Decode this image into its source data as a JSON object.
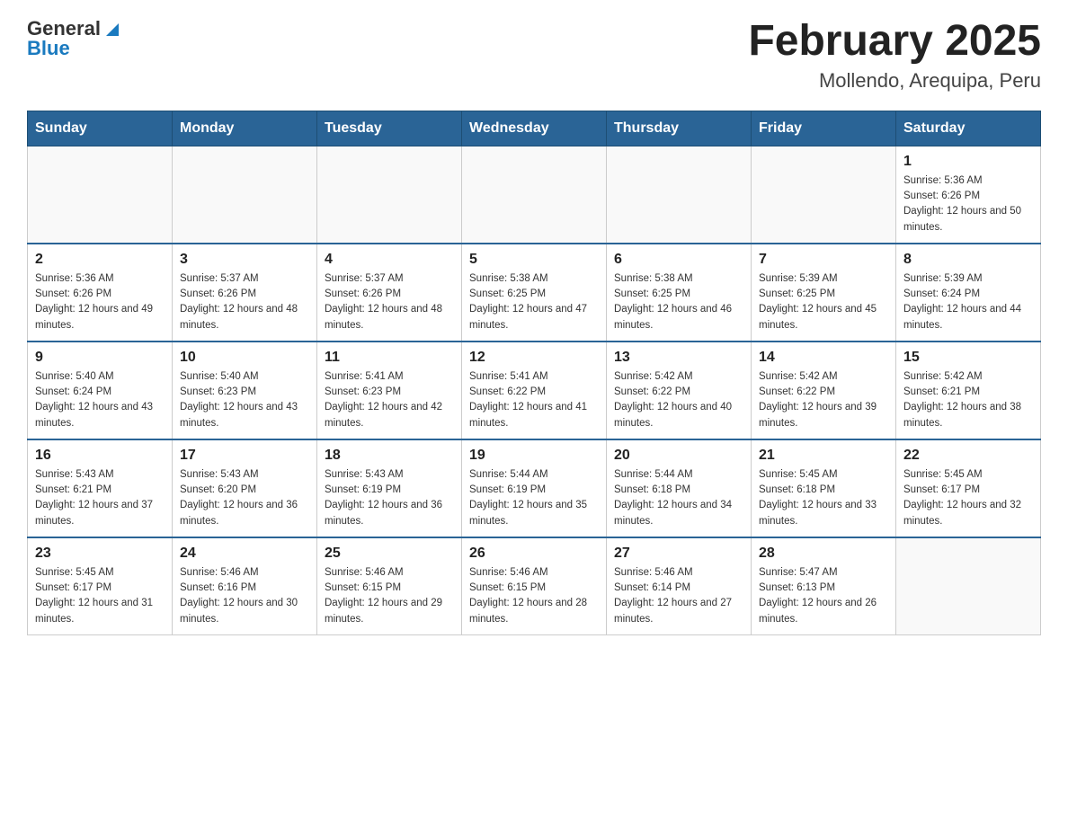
{
  "header": {
    "logo": {
      "general": "General",
      "blue": "Blue"
    },
    "title": "February 2025",
    "location": "Mollendo, Arequipa, Peru"
  },
  "days_of_week": [
    "Sunday",
    "Monday",
    "Tuesday",
    "Wednesday",
    "Thursday",
    "Friday",
    "Saturday"
  ],
  "weeks": [
    [
      {
        "day": "",
        "sunrise": "",
        "sunset": "",
        "daylight": ""
      },
      {
        "day": "",
        "sunrise": "",
        "sunset": "",
        "daylight": ""
      },
      {
        "day": "",
        "sunrise": "",
        "sunset": "",
        "daylight": ""
      },
      {
        "day": "",
        "sunrise": "",
        "sunset": "",
        "daylight": ""
      },
      {
        "day": "",
        "sunrise": "",
        "sunset": "",
        "daylight": ""
      },
      {
        "day": "",
        "sunrise": "",
        "sunset": "",
        "daylight": ""
      },
      {
        "day": "1",
        "sunrise": "Sunrise: 5:36 AM",
        "sunset": "Sunset: 6:26 PM",
        "daylight": "Daylight: 12 hours and 50 minutes."
      }
    ],
    [
      {
        "day": "2",
        "sunrise": "Sunrise: 5:36 AM",
        "sunset": "Sunset: 6:26 PM",
        "daylight": "Daylight: 12 hours and 49 minutes."
      },
      {
        "day": "3",
        "sunrise": "Sunrise: 5:37 AM",
        "sunset": "Sunset: 6:26 PM",
        "daylight": "Daylight: 12 hours and 48 minutes."
      },
      {
        "day": "4",
        "sunrise": "Sunrise: 5:37 AM",
        "sunset": "Sunset: 6:26 PM",
        "daylight": "Daylight: 12 hours and 48 minutes."
      },
      {
        "day": "5",
        "sunrise": "Sunrise: 5:38 AM",
        "sunset": "Sunset: 6:25 PM",
        "daylight": "Daylight: 12 hours and 47 minutes."
      },
      {
        "day": "6",
        "sunrise": "Sunrise: 5:38 AM",
        "sunset": "Sunset: 6:25 PM",
        "daylight": "Daylight: 12 hours and 46 minutes."
      },
      {
        "day": "7",
        "sunrise": "Sunrise: 5:39 AM",
        "sunset": "Sunset: 6:25 PM",
        "daylight": "Daylight: 12 hours and 45 minutes."
      },
      {
        "day": "8",
        "sunrise": "Sunrise: 5:39 AM",
        "sunset": "Sunset: 6:24 PM",
        "daylight": "Daylight: 12 hours and 44 minutes."
      }
    ],
    [
      {
        "day": "9",
        "sunrise": "Sunrise: 5:40 AM",
        "sunset": "Sunset: 6:24 PM",
        "daylight": "Daylight: 12 hours and 43 minutes."
      },
      {
        "day": "10",
        "sunrise": "Sunrise: 5:40 AM",
        "sunset": "Sunset: 6:23 PM",
        "daylight": "Daylight: 12 hours and 43 minutes."
      },
      {
        "day": "11",
        "sunrise": "Sunrise: 5:41 AM",
        "sunset": "Sunset: 6:23 PM",
        "daylight": "Daylight: 12 hours and 42 minutes."
      },
      {
        "day": "12",
        "sunrise": "Sunrise: 5:41 AM",
        "sunset": "Sunset: 6:22 PM",
        "daylight": "Daylight: 12 hours and 41 minutes."
      },
      {
        "day": "13",
        "sunrise": "Sunrise: 5:42 AM",
        "sunset": "Sunset: 6:22 PM",
        "daylight": "Daylight: 12 hours and 40 minutes."
      },
      {
        "day": "14",
        "sunrise": "Sunrise: 5:42 AM",
        "sunset": "Sunset: 6:22 PM",
        "daylight": "Daylight: 12 hours and 39 minutes."
      },
      {
        "day": "15",
        "sunrise": "Sunrise: 5:42 AM",
        "sunset": "Sunset: 6:21 PM",
        "daylight": "Daylight: 12 hours and 38 minutes."
      }
    ],
    [
      {
        "day": "16",
        "sunrise": "Sunrise: 5:43 AM",
        "sunset": "Sunset: 6:21 PM",
        "daylight": "Daylight: 12 hours and 37 minutes."
      },
      {
        "day": "17",
        "sunrise": "Sunrise: 5:43 AM",
        "sunset": "Sunset: 6:20 PM",
        "daylight": "Daylight: 12 hours and 36 minutes."
      },
      {
        "day": "18",
        "sunrise": "Sunrise: 5:43 AM",
        "sunset": "Sunset: 6:19 PM",
        "daylight": "Daylight: 12 hours and 36 minutes."
      },
      {
        "day": "19",
        "sunrise": "Sunrise: 5:44 AM",
        "sunset": "Sunset: 6:19 PM",
        "daylight": "Daylight: 12 hours and 35 minutes."
      },
      {
        "day": "20",
        "sunrise": "Sunrise: 5:44 AM",
        "sunset": "Sunset: 6:18 PM",
        "daylight": "Daylight: 12 hours and 34 minutes."
      },
      {
        "day": "21",
        "sunrise": "Sunrise: 5:45 AM",
        "sunset": "Sunset: 6:18 PM",
        "daylight": "Daylight: 12 hours and 33 minutes."
      },
      {
        "day": "22",
        "sunrise": "Sunrise: 5:45 AM",
        "sunset": "Sunset: 6:17 PM",
        "daylight": "Daylight: 12 hours and 32 minutes."
      }
    ],
    [
      {
        "day": "23",
        "sunrise": "Sunrise: 5:45 AM",
        "sunset": "Sunset: 6:17 PM",
        "daylight": "Daylight: 12 hours and 31 minutes."
      },
      {
        "day": "24",
        "sunrise": "Sunrise: 5:46 AM",
        "sunset": "Sunset: 6:16 PM",
        "daylight": "Daylight: 12 hours and 30 minutes."
      },
      {
        "day": "25",
        "sunrise": "Sunrise: 5:46 AM",
        "sunset": "Sunset: 6:15 PM",
        "daylight": "Daylight: 12 hours and 29 minutes."
      },
      {
        "day": "26",
        "sunrise": "Sunrise: 5:46 AM",
        "sunset": "Sunset: 6:15 PM",
        "daylight": "Daylight: 12 hours and 28 minutes."
      },
      {
        "day": "27",
        "sunrise": "Sunrise: 5:46 AM",
        "sunset": "Sunset: 6:14 PM",
        "daylight": "Daylight: 12 hours and 27 minutes."
      },
      {
        "day": "28",
        "sunrise": "Sunrise: 5:47 AM",
        "sunset": "Sunset: 6:13 PM",
        "daylight": "Daylight: 12 hours and 26 minutes."
      },
      {
        "day": "",
        "sunrise": "",
        "sunset": "",
        "daylight": ""
      }
    ]
  ]
}
